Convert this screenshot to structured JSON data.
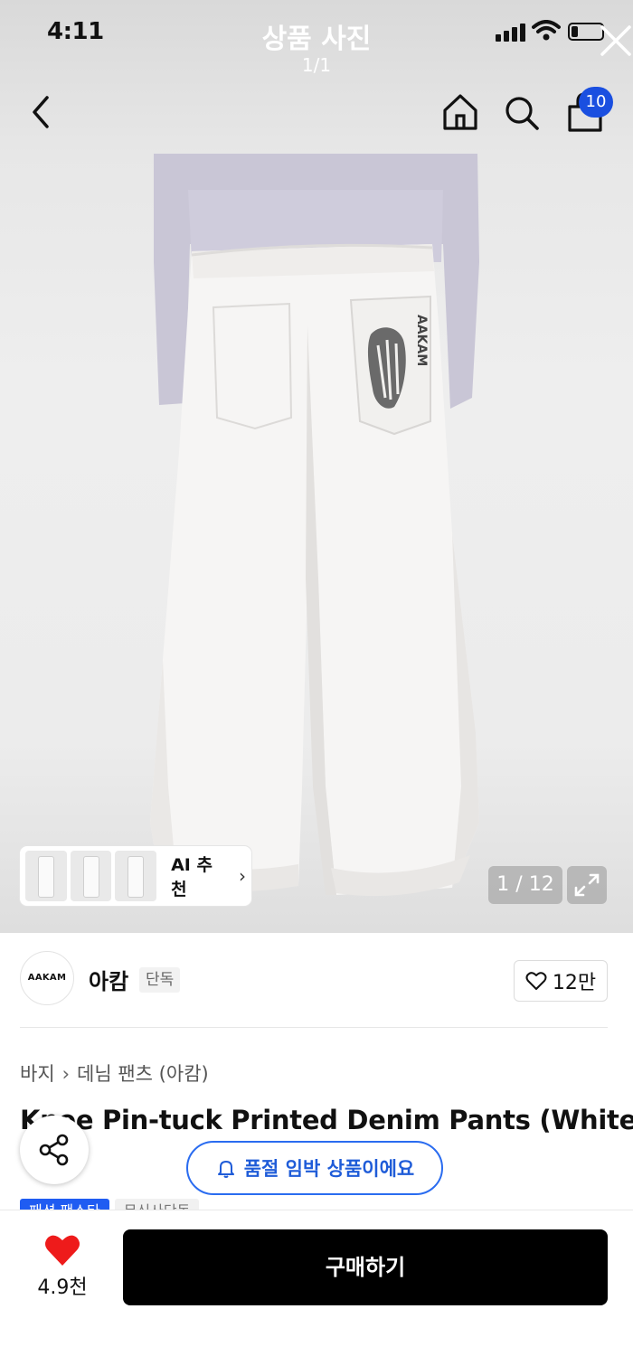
{
  "status_bar": {
    "time": "4:11"
  },
  "viewer": {
    "title": "상품 사진",
    "count": "1/1"
  },
  "nav": {
    "cart_badge": "10"
  },
  "product_image": {
    "ai_recommend_label": "AI 추천",
    "image_counter": "1 / 12",
    "print_text": "AAKAM"
  },
  "brand": {
    "logo_text": "AAKAM",
    "name": "아캄",
    "tag": "단독"
  },
  "like": {
    "count": "12만"
  },
  "breadcrumb": [
    "바지",
    "데님 팬츠 (아캄)"
  ],
  "product": {
    "title": "Knee Pin-tuck Printed Denim Pants (White)"
  },
  "tags": [
    "패션 팬스타",
    "무신사단독"
  ],
  "soldout_notice": "품절 임박 상품이에요",
  "bottom_bar": {
    "wish_count": "4.9천",
    "buy_label": "구매하기"
  },
  "colors": {
    "accent_blue": "#1f5cf2",
    "heart_red": "#ee1b1b",
    "buy_button": "#000000"
  },
  "icons": [
    "signal-icon",
    "wifi-icon",
    "battery-icon",
    "close-icon",
    "back-icon",
    "home-icon",
    "search-icon",
    "cart-icon",
    "chevron-right-icon",
    "expand-icon",
    "heart-outline-icon",
    "share-icon",
    "bell-icon",
    "heart-filled-icon"
  ]
}
